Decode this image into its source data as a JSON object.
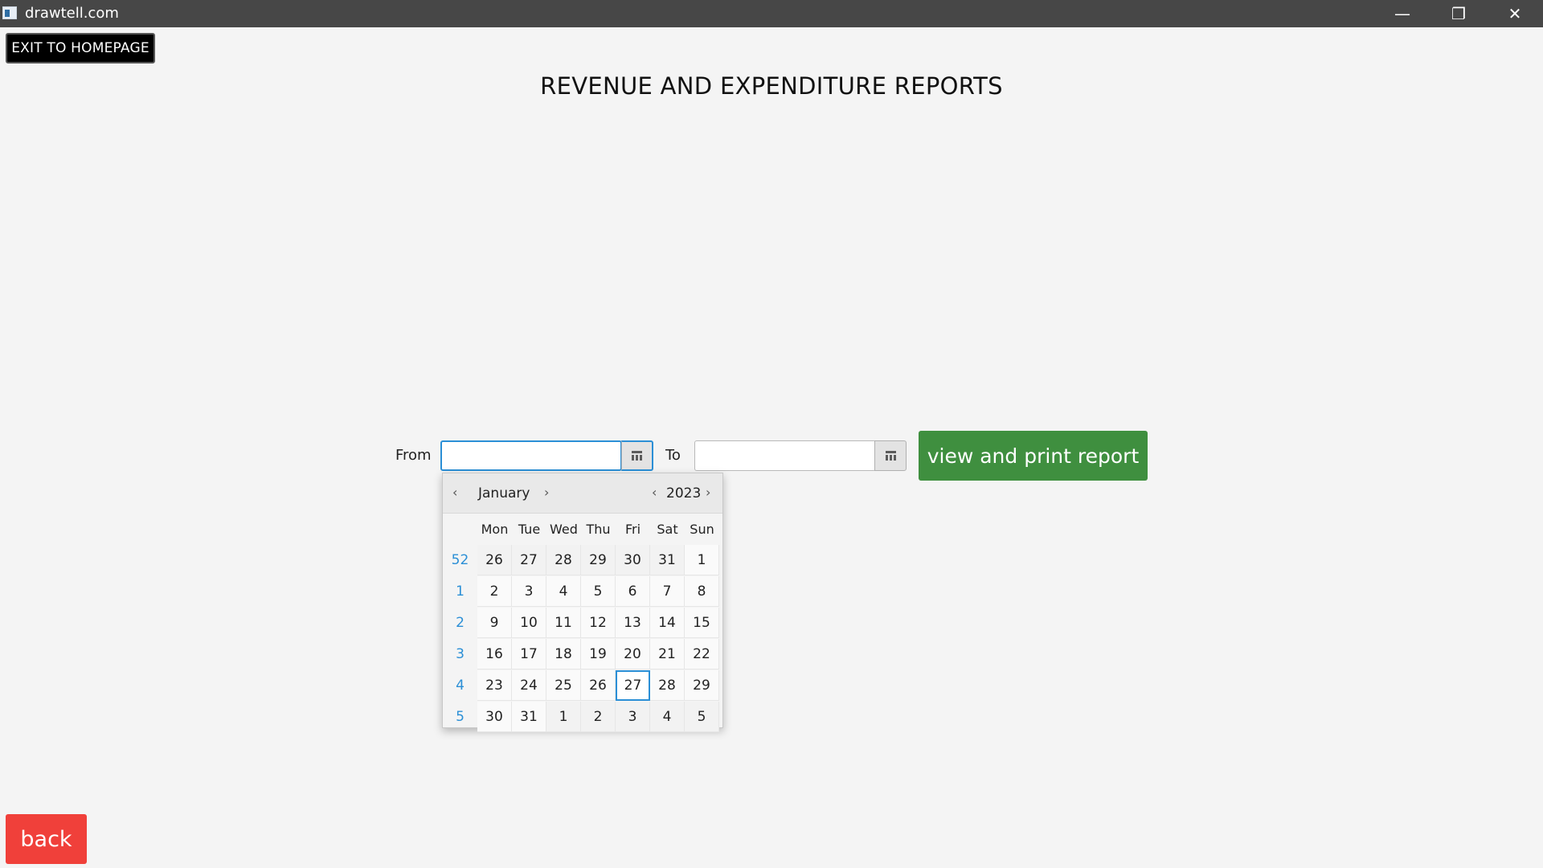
{
  "window": {
    "title": "drawtell.com",
    "minimize": "—",
    "maximize": "❐",
    "close": "✕"
  },
  "buttons": {
    "exit": "EXIT TO HOMEPAGE",
    "print": "view and print report",
    "back": "back"
  },
  "page": {
    "title": "REVENUE AND EXPENDITURE REPORTS"
  },
  "form": {
    "from_label": "From",
    "to_label": "To",
    "from_value": "",
    "to_value": ""
  },
  "picker": {
    "month": "January",
    "year": "2023",
    "weekdays": [
      "Mon",
      "Tue",
      "Wed",
      "Thu",
      "Fri",
      "Sat",
      "Sun"
    ],
    "weeks": [
      {
        "num": "52",
        "days": [
          "26",
          "27",
          "28",
          "29",
          "30",
          "31",
          "1"
        ]
      },
      {
        "num": "1",
        "days": [
          "2",
          "3",
          "4",
          "5",
          "6",
          "7",
          "8"
        ]
      },
      {
        "num": "2",
        "days": [
          "9",
          "10",
          "11",
          "12",
          "13",
          "14",
          "15"
        ]
      },
      {
        "num": "3",
        "days": [
          "16",
          "17",
          "18",
          "19",
          "20",
          "21",
          "22"
        ]
      },
      {
        "num": "4",
        "days": [
          "23",
          "24",
          "25",
          "26",
          "27",
          "28",
          "29"
        ]
      },
      {
        "num": "5",
        "days": [
          "30",
          "31",
          "1",
          "2",
          "3",
          "4",
          "5"
        ]
      }
    ],
    "today": "27",
    "colors": {
      "accent": "#2b8fd6",
      "print_button": "#3f8f3f",
      "back_button": "#f0403a"
    }
  }
}
